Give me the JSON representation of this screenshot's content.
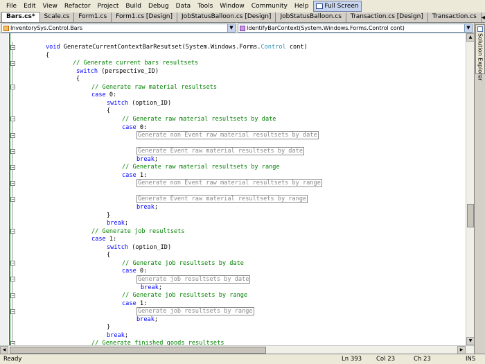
{
  "menu": {
    "items": [
      "File",
      "Edit",
      "View",
      "Refactor",
      "Project",
      "Build",
      "Debug",
      "Data",
      "Tools",
      "Window",
      "Community",
      "Help"
    ],
    "full_screen_label": "Full Screen"
  },
  "tabs": [
    {
      "label": "Bars.cs*",
      "active": true
    },
    {
      "label": "Scale.cs",
      "active": false
    },
    {
      "label": "Form1.cs",
      "active": false
    },
    {
      "label": "Form1.cs [Design]",
      "active": false
    },
    {
      "label": "JobStatusBalloon.cs [Design]",
      "active": false
    },
    {
      "label": "JobStatusBalloon.cs",
      "active": false
    },
    {
      "label": "Transaction.cs [Design]",
      "active": false
    },
    {
      "label": "Transaction.cs",
      "active": false
    }
  ],
  "tab_tools": {
    "scroll_left": "◂",
    "scroll_right": "▸",
    "close": "✕"
  },
  "nav": {
    "class_combo": "InventorySys.Control.Bars",
    "member_combo": "IdentifyBarContext(System.Windows.Forms.Control cont)"
  },
  "code_lines": [
    {
      "indent": 66,
      "fold": true,
      "parts": [
        {
          "t": "void ",
          "c": "kw"
        },
        {
          "t": "GenerateCurrentContextBarResutset(System.Windows.Forms.",
          "c": ""
        },
        {
          "t": "Control",
          "c": "ty"
        },
        {
          "t": " cont)",
          "c": ""
        }
      ]
    },
    {
      "indent": 66,
      "parts": [
        {
          "t": "{",
          "c": ""
        }
      ]
    },
    {
      "indent": 105,
      "fold": true,
      "parts": [
        {
          "t": "// Generate current bars resultsets",
          "c": "cm"
        }
      ]
    },
    {
      "indent": 110,
      "parts": [
        {
          "t": "switch",
          "c": "kw"
        },
        {
          "t": " (perspective_ID)",
          "c": ""
        }
      ]
    },
    {
      "indent": 110,
      "parts": [
        {
          "t": "{",
          "c": ""
        }
      ]
    },
    {
      "indent": 132,
      "fold": true,
      "parts": [
        {
          "t": "// Generate raw material resultsets",
          "c": "cm"
        }
      ]
    },
    {
      "indent": 132,
      "parts": [
        {
          "t": "case",
          "c": "kw"
        },
        {
          "t": " 0:",
          "c": ""
        }
      ]
    },
    {
      "indent": 154,
      "parts": [
        {
          "t": "switch",
          "c": "kw"
        },
        {
          "t": " (option_ID)",
          "c": ""
        }
      ]
    },
    {
      "indent": 154,
      "parts": [
        {
          "t": "{",
          "c": ""
        }
      ]
    },
    {
      "indent": 176,
      "fold": true,
      "parts": [
        {
          "t": "// Generate raw material resultsets by date",
          "c": "cm"
        }
      ]
    },
    {
      "indent": 176,
      "parts": [
        {
          "t": "case",
          "c": "kw"
        },
        {
          "t": " 0:",
          "c": ""
        }
      ]
    },
    {
      "indent": 197,
      "fold": true,
      "parts": [
        {
          "t": "Generate non Event raw material resultsets by date",
          "c": "box"
        }
      ]
    },
    {
      "indent": 197,
      "parts": []
    },
    {
      "indent": 197,
      "fold": true,
      "parts": [
        {
          "t": "Generate Event raw material resultsets by date",
          "c": "box"
        }
      ]
    },
    {
      "indent": 197,
      "parts": [
        {
          "t": "break",
          "c": "kw"
        },
        {
          "t": ";",
          "c": ""
        }
      ]
    },
    {
      "indent": 176,
      "fold": true,
      "parts": [
        {
          "t": "// Generate raw material resultsets by range",
          "c": "cm"
        }
      ]
    },
    {
      "indent": 176,
      "parts": [
        {
          "t": "case",
          "c": "kw"
        },
        {
          "t": " 1:",
          "c": ""
        }
      ]
    },
    {
      "indent": 197,
      "fold": true,
      "parts": [
        {
          "t": "Generate non Event raw material resultsets by range",
          "c": "box"
        }
      ]
    },
    {
      "indent": 197,
      "parts": []
    },
    {
      "indent": 197,
      "fold": true,
      "parts": [
        {
          "t": "Generate Event raw material resultsets by range",
          "c": "box"
        }
      ]
    },
    {
      "indent": 197,
      "parts": [
        {
          "t": "break",
          "c": "kw"
        },
        {
          "t": ";",
          "c": ""
        }
      ]
    },
    {
      "indent": 154,
      "parts": [
        {
          "t": "}",
          "c": ""
        }
      ]
    },
    {
      "indent": 154,
      "parts": [
        {
          "t": "break",
          "c": "kw"
        },
        {
          "t": ";",
          "c": ""
        }
      ]
    },
    {
      "indent": 132,
      "fold": true,
      "parts": [
        {
          "t": "// Generate job resultsets",
          "c": "cm"
        }
      ]
    },
    {
      "indent": 132,
      "parts": [
        {
          "t": "case",
          "c": "kw"
        },
        {
          "t": " 1:",
          "c": ""
        }
      ]
    },
    {
      "indent": 154,
      "parts": [
        {
          "t": "switch",
          "c": "kw"
        },
        {
          "t": " (option_ID)",
          "c": ""
        }
      ]
    },
    {
      "indent": 154,
      "parts": [
        {
          "t": "{",
          "c": ""
        }
      ]
    },
    {
      "indent": 176,
      "fold": true,
      "parts": [
        {
          "t": "// Generate job resultsets by date",
          "c": "cm"
        }
      ]
    },
    {
      "indent": 176,
      "parts": [
        {
          "t": "case",
          "c": "kw"
        },
        {
          "t": " 0:",
          "c": ""
        }
      ]
    },
    {
      "indent": 197,
      "fold": true,
      "parts": [
        {
          "t": "Generate job resultsets by date",
          "c": "box"
        }
      ]
    },
    {
      "indent": 203,
      "parts": [
        {
          "t": "break",
          "c": "kw"
        },
        {
          "t": ";",
          "c": ""
        }
      ]
    },
    {
      "indent": 176,
      "fold": true,
      "parts": [
        {
          "t": "// Generate job resultsets by range",
          "c": "cm"
        }
      ]
    },
    {
      "indent": 176,
      "parts": [
        {
          "t": "case",
          "c": "kw"
        },
        {
          "t": " 1:",
          "c": ""
        }
      ]
    },
    {
      "indent": 197,
      "fold": true,
      "parts": [
        {
          "t": "Generate job resultsets by range",
          "c": "box"
        }
      ]
    },
    {
      "indent": 197,
      "parts": [
        {
          "t": "break",
          "c": "kw"
        },
        {
          "t": ";",
          "c": ""
        }
      ]
    },
    {
      "indent": 154,
      "parts": [
        {
          "t": "}",
          "c": ""
        }
      ]
    },
    {
      "indent": 154,
      "parts": [
        {
          "t": "break",
          "c": "kw"
        },
        {
          "t": ";",
          "c": ""
        }
      ]
    },
    {
      "indent": 132,
      "fold": true,
      "parts": [
        {
          "t": "// Generate finished goods resultsets",
          "c": "cm"
        }
      ]
    }
  ],
  "side_panel": {
    "label": "Solution Explorer"
  },
  "status": {
    "ready": "Ready",
    "line": "Ln 393",
    "col": "Col 23",
    "ch": "Ch 23",
    "mode": "INS"
  }
}
